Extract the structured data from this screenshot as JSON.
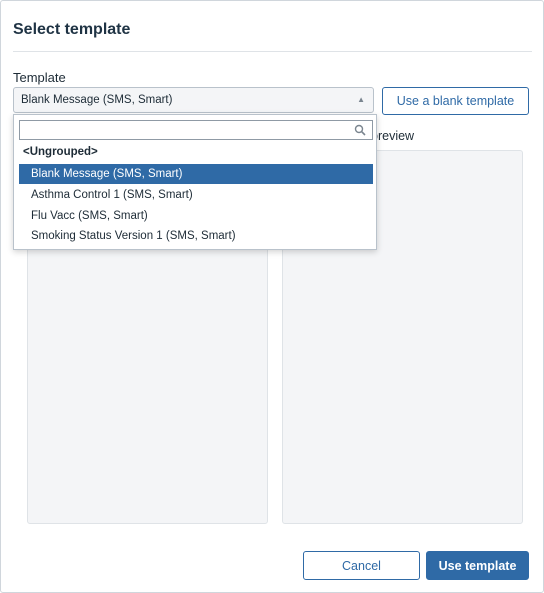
{
  "dialog": {
    "title": "Select template"
  },
  "template_field": {
    "label": "Template",
    "selected_value": "Blank Message (SMS, Smart)"
  },
  "blank_button": {
    "label": "Use a blank template"
  },
  "preview": {
    "label_visible": "preview"
  },
  "dropdown": {
    "search_value": "",
    "group_label": "<Ungrouped>",
    "items": [
      {
        "label": "Blank Message (SMS, Smart)",
        "selected": true
      },
      {
        "label": "Asthma Control 1 (SMS, Smart)",
        "selected": false
      },
      {
        "label": "Flu Vacc (SMS, Smart)",
        "selected": false
      },
      {
        "label": "Smoking Status Version 1 (SMS, Smart)",
        "selected": false
      }
    ]
  },
  "footer": {
    "cancel_label": "Cancel",
    "use_label": "Use template"
  },
  "colors": {
    "accent": "#2f6aa6",
    "panel_bg": "#f4f5f7",
    "border": "#b9c2cb"
  },
  "icons": {
    "search": "search-icon",
    "caret": "caret-up-icon"
  }
}
